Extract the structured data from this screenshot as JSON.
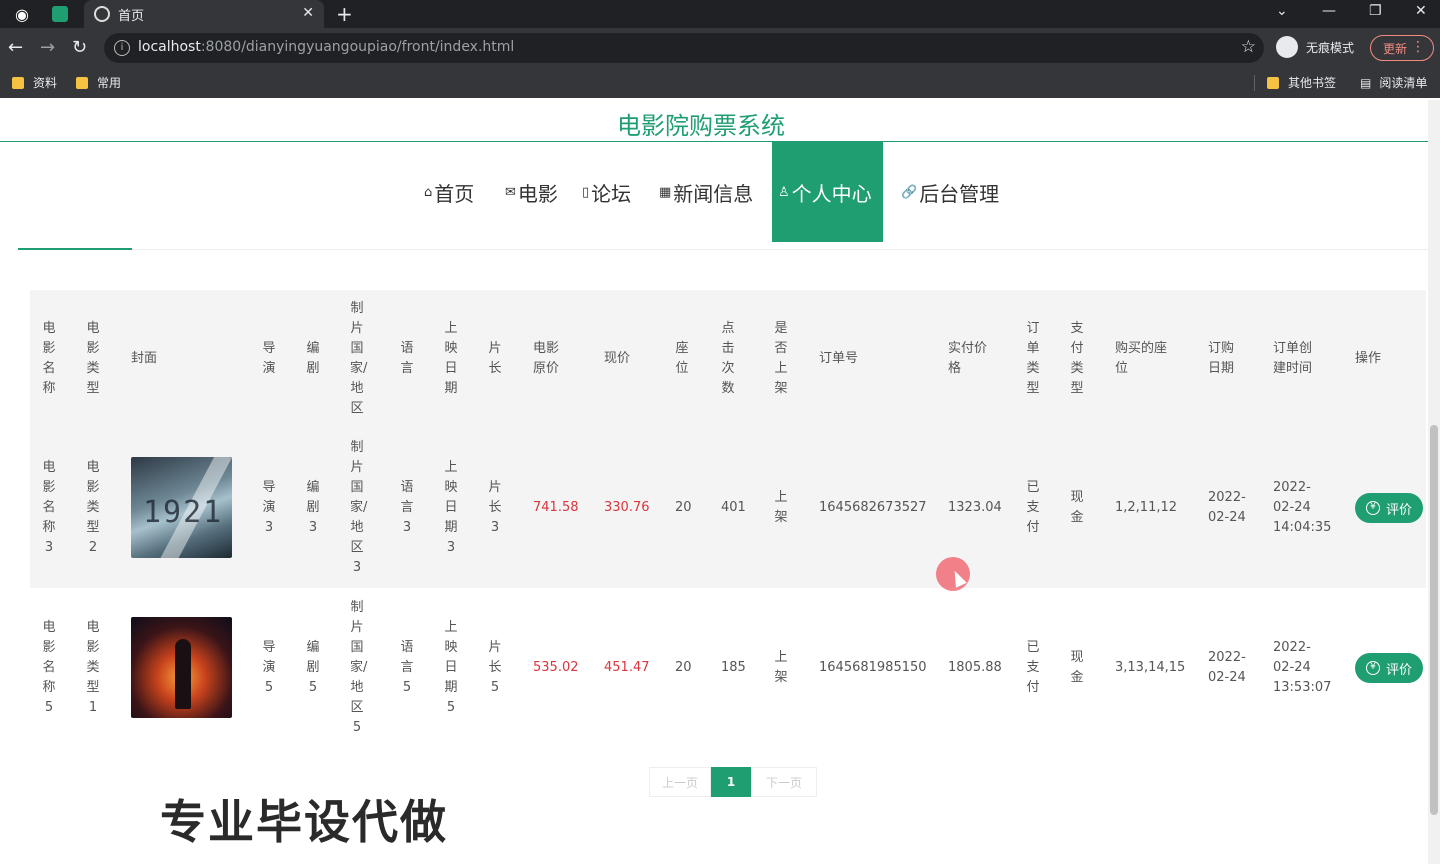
{
  "browser": {
    "tab_title": "首页",
    "url_host": "localhost",
    "url_rest": ":8080/dianyingyuangoupiao/front/index.html",
    "incognito_label": "无痕模式",
    "update_label": "更新",
    "bookmarks": [
      "资料",
      "常用"
    ],
    "other_bookmarks": "其他书签",
    "reading_list": "阅读清单"
  },
  "site": {
    "title": "电影院购票系统",
    "nav": [
      {
        "label": "首页",
        "icon": "⌂"
      },
      {
        "label": "电影",
        "icon": "✉"
      },
      {
        "label": "论坛",
        "icon": "▯"
      },
      {
        "label": "新闻信息",
        "icon": "▦"
      },
      {
        "label": "个人中心",
        "icon": "♙"
      },
      {
        "label": "后台管理",
        "icon": "🔗"
      }
    ]
  },
  "table": {
    "headers": [
      "电影名称",
      "电影类型",
      "封面",
      "导演",
      "编剧",
      "制片国家/地区",
      "语言",
      "上映日期",
      "片长",
      "电影原价",
      "现价",
      "座位",
      "点击次数",
      "是否上架",
      "订单号",
      "实付价格",
      "订单类型",
      "支付类型",
      "购买的座位",
      "订购日期",
      "订单创建时间",
      "操作"
    ],
    "rows": [
      {
        "name": "电影名称3",
        "type": "电影类型2",
        "director": "导演3",
        "writer": "编剧3",
        "country": "制片国家/地区3",
        "lang": "语言3",
        "date": "上映日期3",
        "length": "片长3",
        "orig": "741.58",
        "price": "330.76",
        "seat": "20",
        "clicks": "401",
        "shelf": "上架",
        "order_no": "1645682673527",
        "paid": "1323.04",
        "order_type": "已支付",
        "pay_type": "现金",
        "seats": "1,2,11,12",
        "order_date": "2022-02-24",
        "created": "2022-02-24 14:04:35",
        "action": "评价",
        "cover_text": "1921"
      },
      {
        "name": "电影名称5",
        "type": "电影类型1",
        "director": "导演5",
        "writer": "编剧5",
        "country": "制片国家/地区5",
        "lang": "语言5",
        "date": "上映日期5",
        "length": "片长5",
        "orig": "535.02",
        "price": "451.47",
        "seat": "20",
        "clicks": "185",
        "shelf": "上架",
        "order_no": "1645681985150",
        "paid": "1805.88",
        "order_type": "已支付",
        "pay_type": "现金",
        "seats": "3,13,14,15",
        "order_date": "2022-02-24",
        "created": "2022-02-24 13:53:07",
        "action": "评价"
      }
    ]
  },
  "pager": {
    "prev": "上一页",
    "current": "1",
    "next": "下一页"
  },
  "watermark": "专业毕设代做",
  "colors": {
    "accent": "#1f9e72",
    "price": "#d9363e"
  }
}
